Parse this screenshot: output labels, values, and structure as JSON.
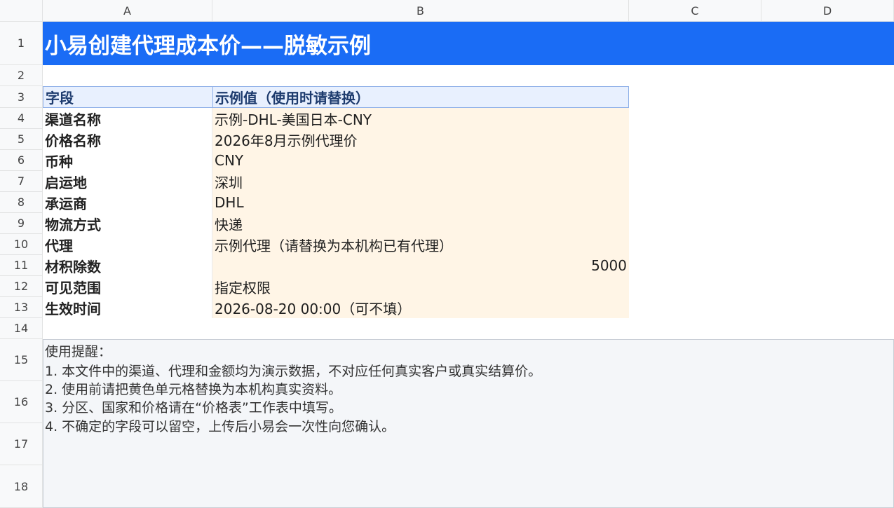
{
  "columns": [
    "A",
    "B",
    "C",
    "D"
  ],
  "rows": [
    "1",
    "2",
    "3",
    "4",
    "5",
    "6",
    "7",
    "8",
    "9",
    "10",
    "11",
    "12",
    "13",
    "14",
    "15",
    "16",
    "17",
    "18"
  ],
  "title": "小易创建代理成本价——脱敏示例",
  "table": {
    "header": {
      "field": "字段",
      "value": "示例值（使用时请替换）"
    },
    "rows": [
      {
        "field": "渠道名称",
        "value": "示例-DHL-美国日本-CNY"
      },
      {
        "field": "价格名称",
        "value": "2026年8月示例代理价"
      },
      {
        "field": "币种",
        "value": "CNY"
      },
      {
        "field": "启运地",
        "value": "深圳"
      },
      {
        "field": "承运商",
        "value": "DHL"
      },
      {
        "field": "物流方式",
        "value": "快递"
      },
      {
        "field": "代理",
        "value": "示例代理（请替换为本机构已有代理）"
      },
      {
        "field": "材积除数",
        "value": "5000"
      },
      {
        "field": "可见范围",
        "value": "指定权限"
      },
      {
        "field": "生效时间",
        "value": "2026-08-20 00:00（可不填）"
      }
    ]
  },
  "notes": [
    "使用提醒：",
    "1. 本文件中的渠道、代理和金额均为演示数据，不对应任何真实客户或真实结算价。",
    "2. 使用前请把黄色单元格替换为本机构真实资料。",
    "3. 分区、国家和价格请在“价格表”工作表中填写。",
    "4. 不确定的字段可以留空，上传后小易会一次性向您确认。"
  ],
  "colors": {
    "title_band": "#1a6cf5",
    "header_fill": "#e8f0fe",
    "value_fill": "#fff5e6",
    "notes_fill": "#f4f6f9"
  }
}
